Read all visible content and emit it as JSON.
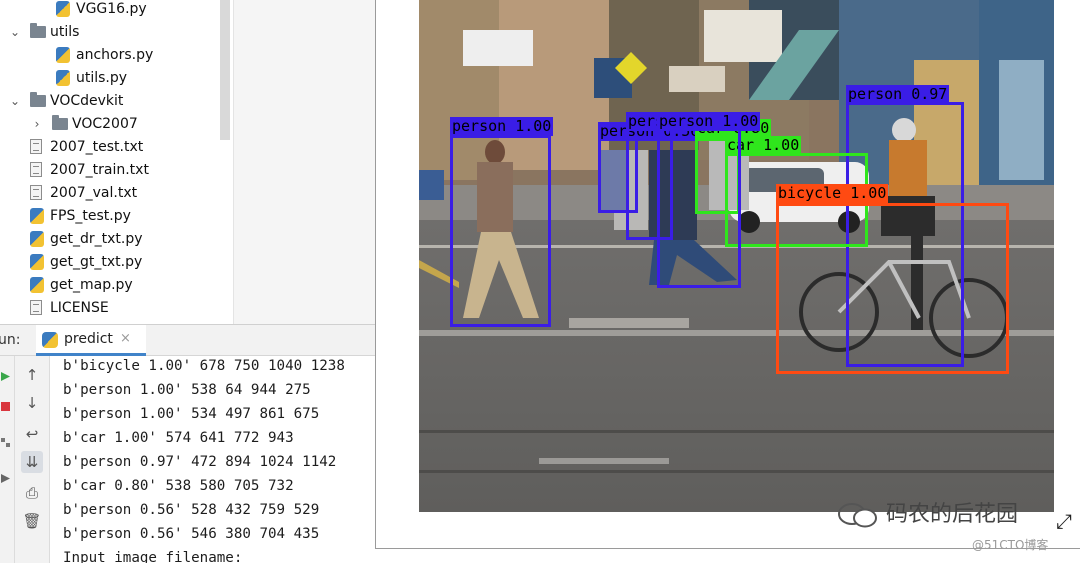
{
  "project_tree": {
    "items": [
      {
        "label": "VGG16.py",
        "type": "py"
      },
      {
        "label": "utils",
        "type": "folder",
        "expanded": true
      },
      {
        "label": "anchors.py",
        "type": "py"
      },
      {
        "label": "utils.py",
        "type": "py"
      },
      {
        "label": "VOCdevkit",
        "type": "folder",
        "expanded": true
      },
      {
        "label": "VOC2007",
        "type": "folder",
        "expanded": false
      },
      {
        "label": "2007_test.txt",
        "type": "txt"
      },
      {
        "label": "2007_train.txt",
        "type": "txt"
      },
      {
        "label": "2007_val.txt",
        "type": "txt"
      },
      {
        "label": "FPS_test.py",
        "type": "py"
      },
      {
        "label": "get_dr_txt.py",
        "type": "py"
      },
      {
        "label": "get_gt_txt.py",
        "type": "py"
      },
      {
        "label": "get_map.py",
        "type": "py"
      },
      {
        "label": "LICENSE",
        "type": "txt"
      }
    ]
  },
  "run_panel": {
    "label": "un:",
    "tab": {
      "label": "predict",
      "close": "×"
    },
    "console_lines": [
      "b'bicycle 1.00' 678 750 1040 1238",
      "b'person 1.00' 538 64 944 275",
      "b'person 1.00' 534 497 861 675",
      "b'car 1.00' 574 641 772 943",
      "b'person 0.97' 472 894 1024 1142",
      "b'car 0.80' 538 580 705 732",
      "b'person 0.56' 528 432 759 529",
      "b'person 0.56' 546 380 704 435",
      "Input image filename:"
    ],
    "toolbar_icons": [
      "up-arrow-icon",
      "down-arrow-icon",
      "soft-wrap-icon",
      "scroll-to-end-icon",
      "print-icon",
      "trash-icon"
    ]
  },
  "detections": [
    {
      "label": "person 1.00",
      "color": "#3a1de6"
    },
    {
      "label": "person 0.56",
      "color": "#3a1de6"
    },
    {
      "label": "person 0.56",
      "color": "#3a1de6"
    },
    {
      "label": "person 0.97",
      "color": "#3a1de6"
    },
    {
      "label": "car 0.80",
      "color": "#2fe61c"
    },
    {
      "label": "car 1.00",
      "color": "#2fe61c"
    },
    {
      "label": "bicycle 1.00",
      "color": "#ff4a12"
    },
    {
      "label": "person 1.00",
      "color": "#3a1de6"
    }
  ],
  "watermark": {
    "text": "码农的后花园"
  },
  "credit": "@51CTO博客"
}
